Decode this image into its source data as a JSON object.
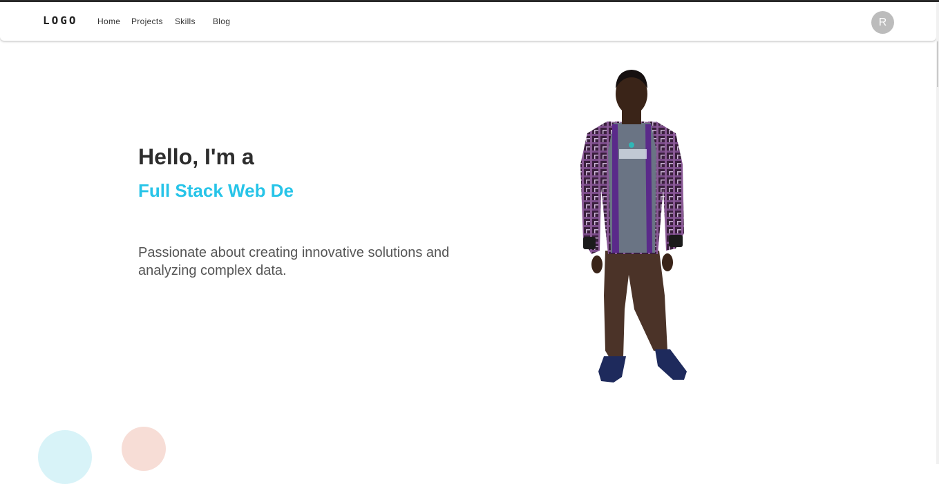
{
  "navbar": {
    "logo": "LOGO",
    "links": [
      {
        "label": "Home"
      },
      {
        "label": "Projects"
      },
      {
        "label": "Skills"
      },
      {
        "label": "Blog"
      }
    ],
    "avatar_initial": "R"
  },
  "hero": {
    "greeting": "Hello, I'm a",
    "role": "Full Stack Web De",
    "description": "Passionate about creating innovative solutions and analyzing complex data."
  },
  "colors": {
    "accent": "#27c4e8",
    "heading": "#2d2d2d",
    "avatar_bg": "#bcbcbc",
    "circle_blue": "#d8f3f8",
    "circle_pink": "#f7ddd6"
  }
}
